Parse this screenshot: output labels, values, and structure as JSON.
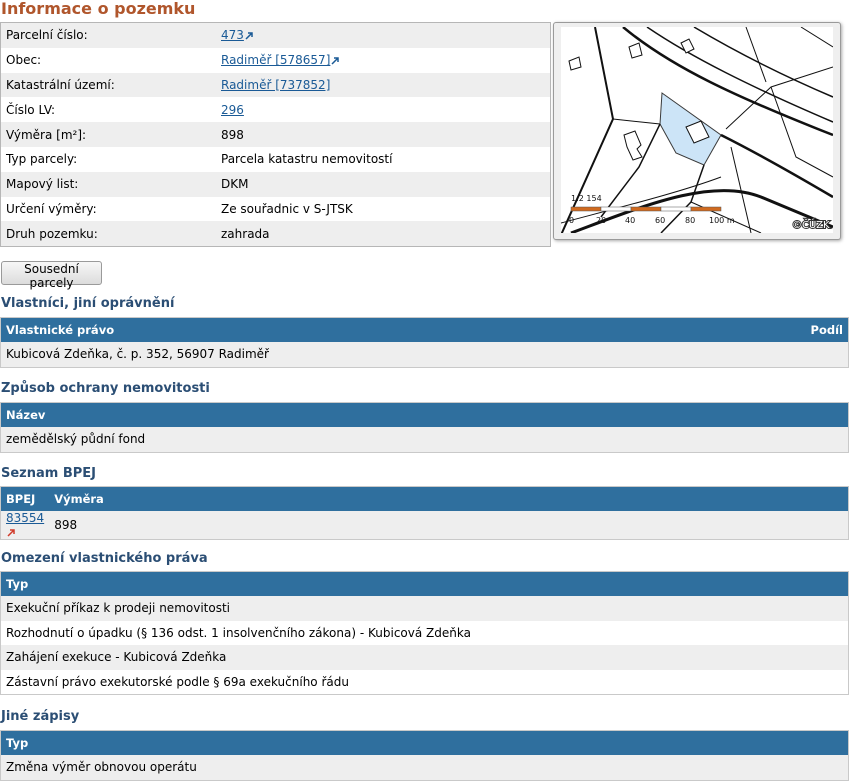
{
  "page": {
    "title": "Informace o pozemku"
  },
  "parcel": {
    "rows": [
      {
        "label": "Parcelní číslo:",
        "value": "473",
        "link": true
      },
      {
        "label": "Obec:",
        "value": "Radiměř [578657]",
        "link": true
      },
      {
        "label": "Katastrální území:",
        "value": "Radiměř [737852]",
        "link": true,
        "noicon": true
      },
      {
        "label": "Číslo LV:",
        "value": "296",
        "link": true,
        "noicon": true
      },
      {
        "label": "Výměra [m²]:",
        "value": "898"
      },
      {
        "label": "Typ parcely:",
        "value": "Parcela katastru nemovitostí"
      },
      {
        "label": "Mapový list:",
        "value": "DKM"
      },
      {
        "label": "Určení výměry:",
        "value": "Ze souřadnic v S-JTSK"
      },
      {
        "label": "Druh pozemku:",
        "value": "zahrada"
      }
    ]
  },
  "map": {
    "scale": "1:2 154",
    "ticks": [
      "0",
      "20",
      "40",
      "60",
      "80",
      "100 m"
    ],
    "copyright": "©ČÚZK",
    "highlight_color": "#cce4f7"
  },
  "buttons": {
    "neighbors": "Sousední parcely"
  },
  "owners": {
    "title": "Vlastníci, jiní oprávnění",
    "col1": "Vlastnické právo",
    "col2": "Podíl",
    "rows": [
      "Kubicová Zdeňka, č. p. 352, 56907 Radiměř"
    ]
  },
  "protection": {
    "title": "Způsob ochrany nemovitosti",
    "col1": "Název",
    "rows": [
      "zemědělský půdní fond"
    ]
  },
  "bpej": {
    "title": "Seznam BPEJ",
    "col1": "BPEJ",
    "col2": "Výměra",
    "rows": [
      {
        "code": "83554",
        "area": "898"
      }
    ]
  },
  "restrictions": {
    "title": "Omezení vlastnického práva",
    "col1": "Typ",
    "rows": [
      "Exekuční příkaz k prodeji nemovitosti",
      "Rozhodnutí o úpadku (§ 136 odst. 1 insolvenčního zákona) - Kubicová Zdeňka",
      "Zahájení exekuce - Kubicová Zdeňka",
      "Zástavní právo exekutorské podle § 69a exekučního řádu"
    ]
  },
  "other": {
    "title": "Jiné zápisy",
    "col1": "Typ",
    "rows": [
      "Změna výměr obnovou operátu"
    ]
  },
  "colors": {
    "header_bg": "#2f6f9e",
    "title": "#b0562c",
    "section_title": "#2b4e74",
    "link": "#1a5a96"
  }
}
